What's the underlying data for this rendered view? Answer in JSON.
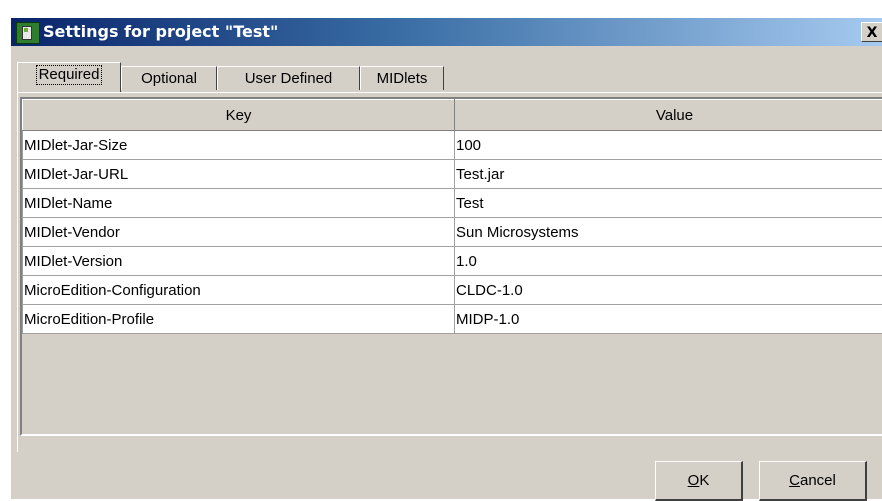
{
  "window": {
    "title": "Settings for project \"Test\"",
    "close_label": "X"
  },
  "tabs": [
    {
      "label": "Required",
      "active": true
    },
    {
      "label": "Optional",
      "active": false
    },
    {
      "label": "User Defined",
      "active": false
    },
    {
      "label": "MIDlets",
      "active": false
    }
  ],
  "table": {
    "columns": [
      "Key",
      "Value"
    ],
    "rows": [
      [
        "MIDlet-Jar-Size",
        "100"
      ],
      [
        "MIDlet-Jar-URL",
        "Test.jar"
      ],
      [
        "MIDlet-Name",
        "Test"
      ],
      [
        "MIDlet-Vendor",
        "Sun Microsystems"
      ],
      [
        "MIDlet-Version",
        "1.0"
      ],
      [
        "MicroEdition-Configuration",
        "CLDC-1.0"
      ],
      [
        "MicroEdition-Profile",
        "MIDP-1.0"
      ]
    ]
  },
  "buttons": {
    "ok": {
      "mnemonic": "O",
      "rest": "K"
    },
    "cancel": {
      "mnemonic": "C",
      "rest": "ancel"
    }
  },
  "colors": {
    "titlebar_start": "#0a246a",
    "titlebar_end": "#a6caf0",
    "dialog_face": "#d4d0c8"
  },
  "icons": {
    "app": "midp-app-icon",
    "close": "close-icon"
  }
}
